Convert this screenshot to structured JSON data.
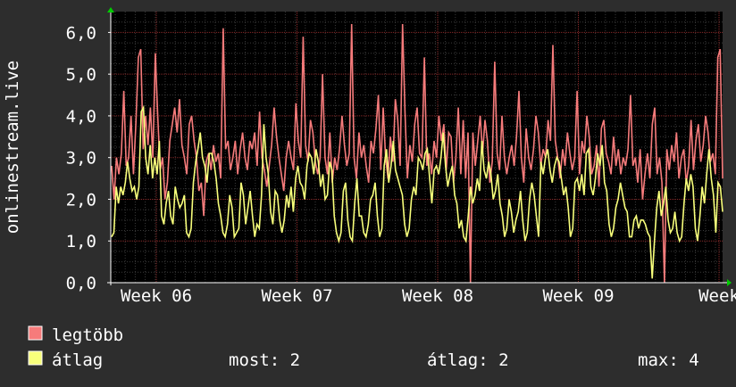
{
  "chart_data": {
    "type": "line",
    "ylabel": "onlinestream.live",
    "ylim": [
      0,
      6.5
    ],
    "yticks": [
      "0,0",
      "1,0",
      "2,0",
      "3,0",
      "4,0",
      "5,0",
      "6,0"
    ],
    "xticks": [
      "Week 06",
      "Week 07",
      "Week 08",
      "Week 09",
      "Week"
    ],
    "grid": true,
    "background": "#000000",
    "series": [
      {
        "name": "legtöbb",
        "color": "#f67b7b",
        "values": [
          2.8,
          2.0,
          3.0,
          2.6,
          3.1,
          4.6,
          2.8,
          3.0,
          4.0,
          2.6,
          3.8,
          5.4,
          5.6,
          3.2,
          4.0,
          3.3,
          4.2,
          3.0,
          5.5,
          4.0,
          2.7,
          3.0,
          2.0,
          2.4,
          3.4,
          3.8,
          4.2,
          3.6,
          4.4,
          3.3,
          3.0,
          2.6,
          3.8,
          4.0,
          3.4,
          3.0,
          2.2,
          2.4,
          1.6,
          2.9,
          3.1,
          2.7,
          3.3,
          2.9,
          3.1,
          2.5,
          6.1,
          3.2,
          3.4,
          2.7,
          3.0,
          3.4,
          2.6,
          3.2,
          3.6,
          3.0,
          2.7,
          3.4,
          3.2,
          3.6,
          2.8,
          4.1,
          3.0,
          2.7,
          2.3,
          2.8,
          3.3,
          4.2,
          3.5,
          3.0,
          2.6,
          2.2,
          3.0,
          3.4,
          3.0,
          2.7,
          4.3,
          3.4,
          3.0,
          5.9,
          3.3,
          2.9,
          3.9,
          3.6,
          2.9,
          2.6,
          3.0,
          5.0,
          3.0,
          2.6,
          3.6,
          2.4,
          3.0,
          2.7,
          3.2,
          4.0,
          3.3,
          2.8,
          3.1,
          6.2,
          3.0,
          2.5,
          3.6,
          3.0,
          3.3,
          2.8,
          2.4,
          3.4,
          3.1,
          3.7,
          4.5,
          2.7,
          4.2,
          3.0,
          2.5,
          3.5,
          2.9,
          4.4,
          3.9,
          2.8,
          6.2,
          4.1,
          2.5,
          3.3,
          2.9,
          3.8,
          4.2,
          3.1,
          3.0,
          5.4,
          2.8,
          3.1,
          2.6,
          3.4,
          3.0,
          4.0,
          3.4,
          3.8,
          2.7,
          3.6,
          3.5,
          2.4,
          3.0,
          4.2,
          2.6,
          3.9,
          2.5,
          3.6,
          0.0,
          3.6,
          2.8,
          3.4,
          4.0,
          3.1,
          3.9,
          3.4,
          2.4,
          2.9,
          5.3,
          3.1,
          2.7,
          4.0,
          3.0,
          2.6,
          3.0,
          3.3,
          2.8,
          3.5,
          4.6,
          3.0,
          2.4,
          3.7,
          3.0,
          2.7,
          3.2,
          4.0,
          3.6,
          2.8,
          3.2,
          3.0,
          3.9,
          3.4,
          5.7,
          3.4,
          3.0,
          2.5,
          3.2,
          2.8,
          3.6,
          3.1,
          2.7,
          3.0,
          4.6,
          2.6,
          3.4,
          3.1,
          4.0,
          3.5,
          2.6,
          2.8,
          3.3,
          2.3,
          3.7,
          3.9,
          3.1,
          2.9,
          2.6,
          3.5,
          2.8,
          3.2,
          2.6,
          3.0,
          2.8,
          3.2,
          4.5,
          2.8,
          3.0,
          2.4,
          3.2,
          2.0,
          2.6,
          3.1,
          2.5,
          3.8,
          4.2,
          2.6,
          3.0,
          2.4,
          0.0,
          3.2,
          2.7,
          3.3,
          2.9,
          3.6,
          2.5,
          3.0,
          3.2,
          2.4,
          2.8,
          3.9,
          2.7,
          3.4,
          3.8,
          2.9,
          3.3,
          4.0,
          3.6,
          2.9,
          3.1,
          2.6,
          5.4,
          5.6,
          2.5
        ]
      },
      {
        "name": "átlag",
        "color": "#f8ff7b",
        "values": [
          1.1,
          1.2,
          2.3,
          1.9,
          2.3,
          2.1,
          2.4,
          2.9,
          2.5,
          2.2,
          2.3,
          2.0,
          2.3,
          4.1,
          4.2,
          3.0,
          2.6,
          3.3,
          2.5,
          3.0,
          2.6,
          3.4,
          1.6,
          1.4,
          1.9,
          2.2,
          1.6,
          1.4,
          2.3,
          2.0,
          1.8,
          1.9,
          2.1,
          1.2,
          1.1,
          1.3,
          2.4,
          2.9,
          3.2,
          3.6,
          3.0,
          2.8,
          2.4,
          3.1,
          3.1,
          2.9,
          2.5,
          1.9,
          1.6,
          1.2,
          1.1,
          1.4,
          2.1,
          1.8,
          1.1,
          1.2,
          1.3,
          2.4,
          2.1,
          1.4,
          1.8,
          2.2,
          1.6,
          1.1,
          1.4,
          1.3,
          2.1,
          3.8,
          3.0,
          2.6,
          1.7,
          1.4,
          2.2,
          2.1,
          1.5,
          1.2,
          1.5,
          2.1,
          1.8,
          2.3,
          1.7,
          2.5,
          2.8,
          2.4,
          2.3,
          2.0,
          2.8,
          3.1,
          3.0,
          2.6,
          3.2,
          2.9,
          2.3,
          2.6,
          2.0,
          2.1,
          2.9,
          2.7,
          1.6,
          1.2,
          1.0,
          1.2,
          2.2,
          2.4,
          1.5,
          1.1,
          1.0,
          1.9,
          2.5,
          1.6,
          1.6,
          1.2,
          1.1,
          1.4,
          2.0,
          2.1,
          2.4,
          1.6,
          1.1,
          1.3,
          2.8,
          3.2,
          2.4,
          2.8,
          3.4,
          2.7,
          2.5,
          2.3,
          2.1,
          1.4,
          1.1,
          1.3,
          2.0,
          2.3,
          2.1,
          3.0,
          2.9,
          2.7,
          3.1,
          3.2,
          2.5,
          1.9,
          2.7,
          2.8,
          2.6,
          3.0,
          3.6,
          2.8,
          2.3,
          2.6,
          2.8,
          2.1,
          1.9,
          1.3,
          1.5,
          1.1,
          1.0,
          1.6,
          2.3,
          1.9,
          2.1,
          2.5,
          2.2,
          3.4,
          2.7,
          2.5,
          2.9,
          2.6,
          2.0,
          2.2,
          2.6,
          1.9,
          1.6,
          1.1,
          1.3,
          2.0,
          1.7,
          1.2,
          1.5,
          1.7,
          2.2,
          1.5,
          1.0,
          1.2,
          2.0,
          2.4,
          2.1,
          1.6,
          1.1,
          2.9,
          2.6,
          3.0,
          3.2,
          2.7,
          2.4,
          2.8,
          3.0,
          2.9,
          2.5,
          2.1,
          2.3,
          1.8,
          1.1,
          1.3,
          2.4,
          2.5,
          2.2,
          2.6,
          2.1,
          3.1,
          3.2,
          2.3,
          2.1,
          2.5,
          3.1,
          2.8,
          3.3,
          2.4,
          2.2,
          1.4,
          1.1,
          1.3,
          1.8,
          2.0,
          2.4,
          2.1,
          1.8,
          1.7,
          1.1,
          1.1,
          1.5,
          1.6,
          1.3,
          1.5,
          1.5,
          1.4,
          1.2,
          1.1,
          0.1,
          1.0,
          1.8,
          2.2,
          1.6,
          1.9,
          2.3,
          1.5,
          1.2,
          1.3,
          1.7,
          1.2,
          1.0,
          1.1,
          1.9,
          2.5,
          2.2,
          2.6,
          2.3,
          1.3,
          1.0,
          1.6,
          2.3,
          1.9,
          2.6,
          3.2,
          2.5,
          2.1,
          1.2,
          2.4,
          2.3,
          1.7
        ]
      }
    ]
  },
  "legend": {
    "items": [
      {
        "label": "legtöbb",
        "color": "#f67b7b"
      },
      {
        "label": "átlag",
        "color": "#f8ff7b"
      }
    ],
    "now_text": "most: 2",
    "avg_text": "átlag: 2",
    "max_text": "max: 4"
  }
}
